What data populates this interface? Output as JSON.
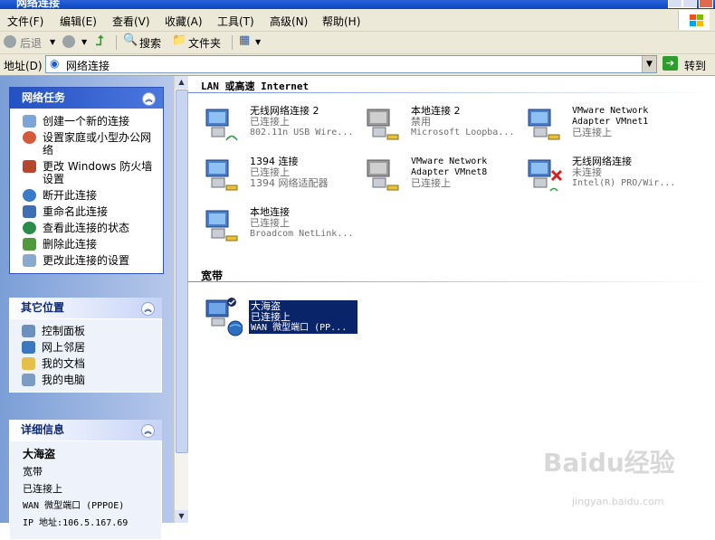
{
  "window": {
    "title": "网络连接"
  },
  "menu": [
    "文件(F)",
    "编辑(E)",
    "查看(V)",
    "收藏(A)",
    "工具(T)",
    "高级(N)",
    "帮助(H)"
  ],
  "toolbar": {
    "back": "后退",
    "search": "搜索",
    "folders": "文件夹"
  },
  "address": {
    "label": "地址(D)",
    "value": "网络连接",
    "go": "转到"
  },
  "tasks": {
    "title": "网络任务",
    "items": [
      "创建一个新的连接",
      "设置家庭或小型办公网络",
      "更改 Windows 防火墙设置",
      "断开此连接",
      "重命名此连接",
      "查看此连接的状态",
      "删除此连接",
      "更改此连接的设置"
    ]
  },
  "places": {
    "title": "其它位置",
    "items": [
      "控制面板",
      "网上邻居",
      "我的文档",
      "我的电脑"
    ]
  },
  "details": {
    "title": "详细信息",
    "name": "大海盗",
    "type": "宽带",
    "status": "已连接上",
    "device": "WAN 微型端口 (PPPOE)",
    "ip": "IP 地址:106.5.167.69"
  },
  "groups": {
    "lan": "LAN 或高速 Internet",
    "broadband": "宽带"
  },
  "connections": [
    {
      "name": "无线网络连接 2",
      "status": "已连接上",
      "device": "802.11n USB Wire..."
    },
    {
      "name": "本地连接 2",
      "status": "禁用",
      "device": "Microsoft Loopba..."
    },
    {
      "name": "VMware Network Adapter VMnet1",
      "status": "已连接上",
      "device": ""
    },
    {
      "name": "1394 连接",
      "status": "已连接上",
      "device": "1394 网络适配器"
    },
    {
      "name": "VMware Network Adapter VMnet8",
      "status": "已连接上",
      "device": ""
    },
    {
      "name": "无线网络连接",
      "status": "未连接",
      "device": "Intel(R) PRO/Wir..."
    },
    {
      "name": "本地连接",
      "status": "已连接上",
      "device": "Broadcom NetLink..."
    }
  ],
  "broadband": {
    "name": "大海盗",
    "status": "已连接上",
    "device": "WAN 微型端口 (PP..."
  },
  "watermark": {
    "text": "Baidu经验",
    "url": "jingyan.baidu.com"
  },
  "colors": {
    "selection": "#0a246a",
    "taskpane": "#7b9ed7",
    "chrome": "#ece9d8"
  }
}
